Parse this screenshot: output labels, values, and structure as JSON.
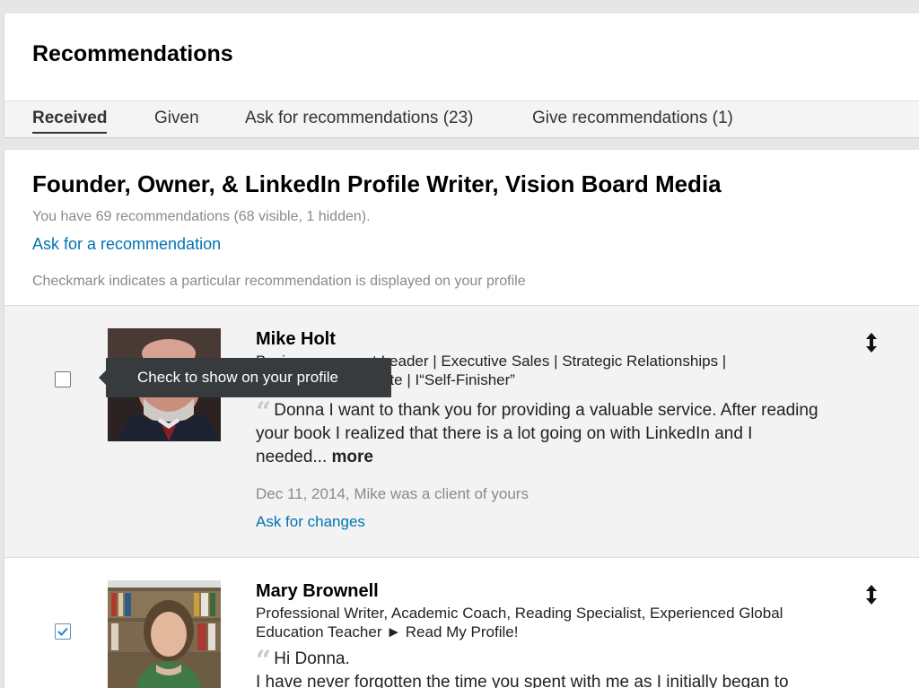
{
  "header": {
    "title": "Recommendations"
  },
  "tabs": [
    {
      "label": "Received",
      "active": true
    },
    {
      "label": "Given",
      "active": false
    },
    {
      "label": "Ask for recommendations (23)",
      "active": false
    },
    {
      "label": "Give recommendations (1)",
      "active": false
    }
  ],
  "position": {
    "title": "Founder, Owner, & LinkedIn Profile Writer, Vision Board Media",
    "summary": "You have 69 recommendations (68 visible, 1 hidden).",
    "ask_link": "Ask for a recommendation",
    "hint": "Checkmark indicates a particular recommendation is displayed on your profile"
  },
  "tooltip": {
    "text": "Check to show on your profile"
  },
  "recommendations": [
    {
      "name": "Mike Holt",
      "headline": "Business Development Leader | Executive Sales | Strategic Relationships | Growth Advocate | I“Self-Finisher”",
      "headline_visible_1": "Busi",
      "headline_visible_2": "ment Leader | Executive Sales | Strategic Relationships |",
      "headline_visible_3": "ate | I“Self-Finisher”",
      "text": "Donna I want to thank you for providing a valuable service. After reading your book I realized that there is a lot going on with LinkedIn and I needed...",
      "more_label": "more",
      "meta": "Dec 11, 2014, Mike was a client of yours",
      "changes_label": "Ask for changes",
      "checked": false
    },
    {
      "name": "Mary Brownell",
      "headline": "Professional Writer, Academic Coach, Reading Specialist, Experienced Global Education Teacher ► Read My Profile!",
      "text_line1": "Hi Donna.",
      "text_line2": "I have never forgotten the time you spent with me as I initially began to",
      "checked": true
    }
  ],
  "colors": {
    "link": "#0073b1",
    "muted": "#8a8a8a",
    "tooltip_bg": "#383b3d",
    "highlight_row": "#f3f3f3"
  }
}
